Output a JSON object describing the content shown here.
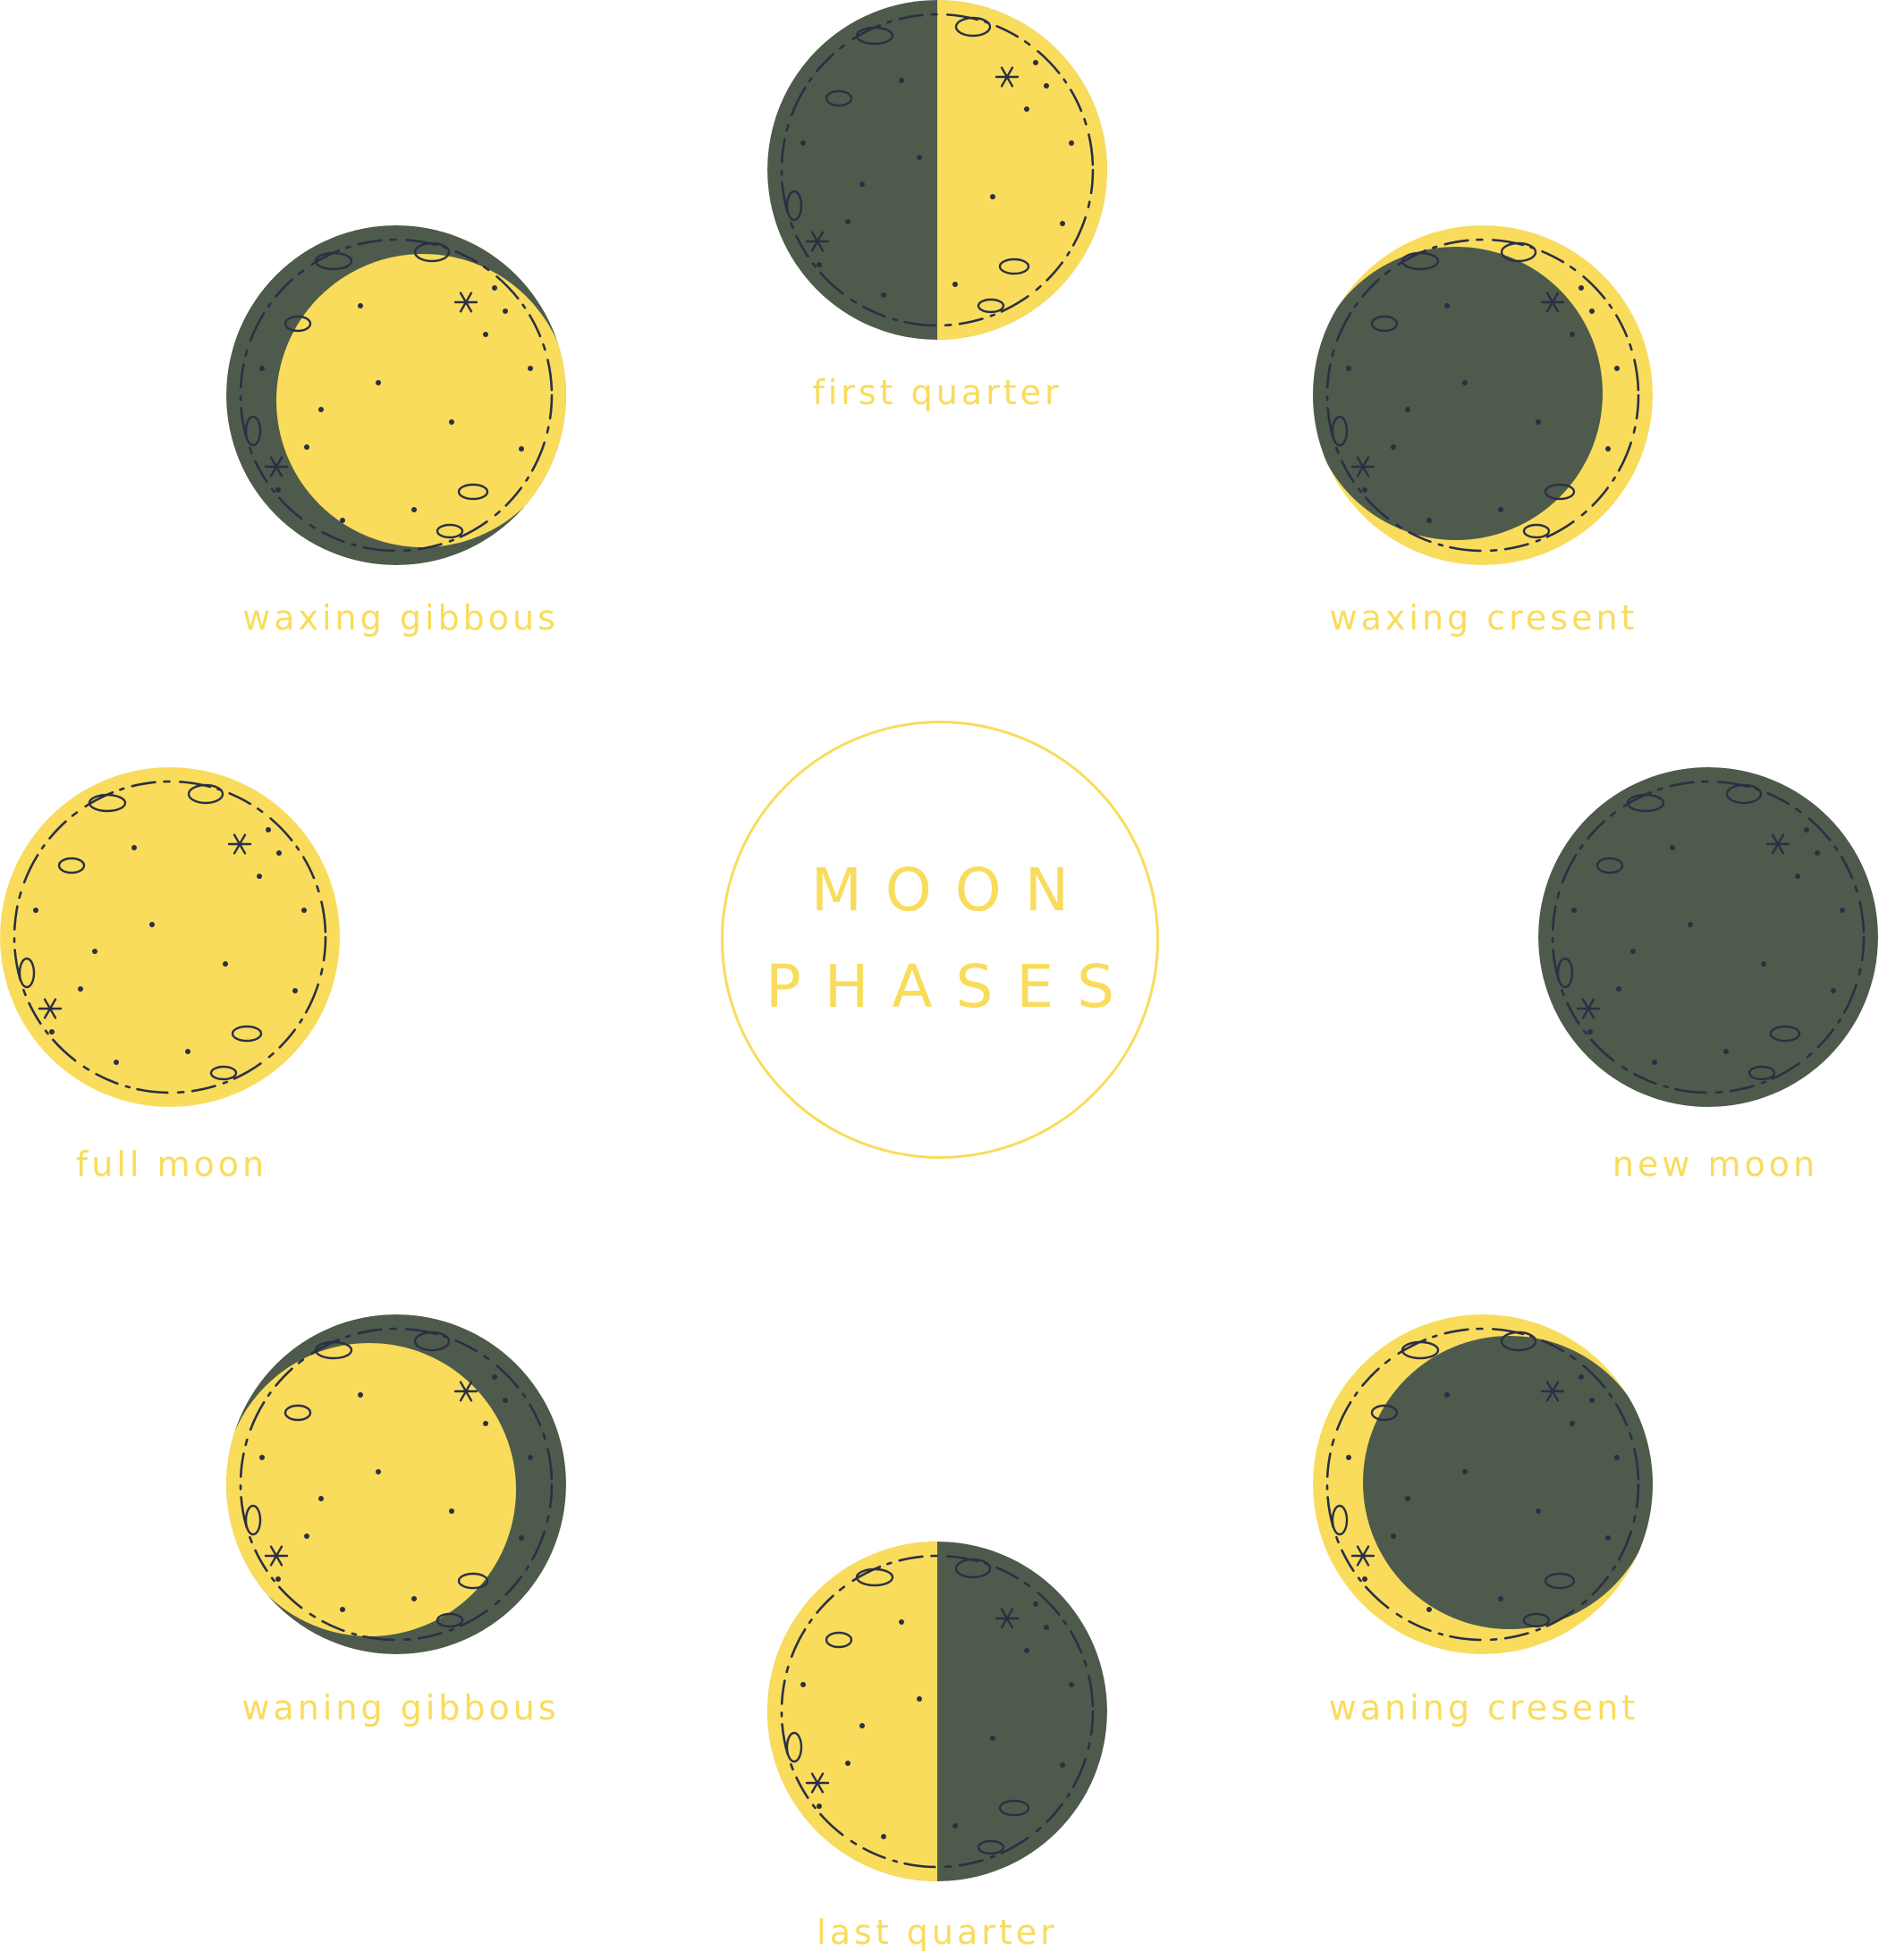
{
  "colors": {
    "light": "#F9DC5C",
    "dark": "#4E5A4C",
    "ink": "#2B2F44"
  },
  "title": {
    "line1": "MOON",
    "line2": "PHASES"
  },
  "phases": [
    {
      "key": "first-quarter",
      "label": "first quarter",
      "icon": "first-quarter-moon-icon"
    },
    {
      "key": "waxing-crescent",
      "label": "waxing cresent",
      "icon": "waxing-crescent-moon-icon"
    },
    {
      "key": "new-moon",
      "label": "new moon",
      "icon": "new-moon-icon"
    },
    {
      "key": "waning-crescent",
      "label": "waning cresent",
      "icon": "waning-crescent-moon-icon"
    },
    {
      "key": "last-quarter",
      "label": "last quarter",
      "icon": "last-quarter-moon-icon"
    },
    {
      "key": "waning-gibbous",
      "label": "waning gibbous",
      "icon": "waning-gibbous-moon-icon"
    },
    {
      "key": "full-moon",
      "label": "full moon",
      "icon": "full-moon-icon"
    },
    {
      "key": "waxing-gibbous",
      "label": "waxing gibbous",
      "icon": "waxing-gibbous-moon-icon"
    }
  ]
}
